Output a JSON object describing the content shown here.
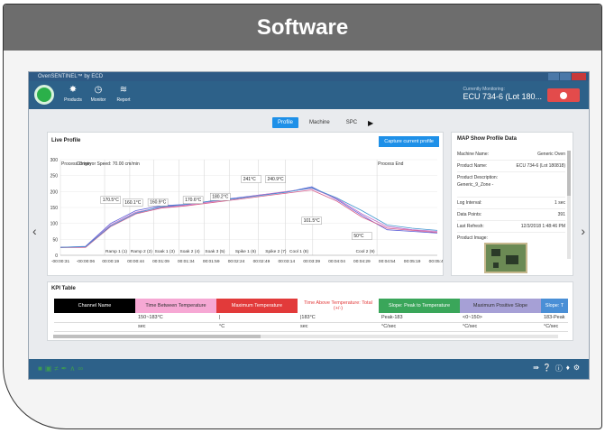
{
  "slide": {
    "title": "Software"
  },
  "window": {
    "title": "OvenSENTINEL™ by ECD"
  },
  "toolbar": {
    "items": [
      {
        "label": "Products",
        "icon": "products-icon"
      },
      {
        "label": "Monitor",
        "icon": "monitor-icon"
      },
      {
        "label": "Report",
        "icon": "report-icon"
      }
    ],
    "monitor_label": "Currently Monitoring:",
    "monitor_value": "ECU 734-6 (Lot 180..."
  },
  "tabs": [
    "Profile",
    "Machine",
    "SPC"
  ],
  "live_profile": {
    "title": "Live Profile",
    "capture_button": "Capture current profile"
  },
  "chart_data": {
    "type": "line",
    "title": "",
    "xlabel": "",
    "ylabel": "",
    "ylim": [
      0,
      300
    ],
    "yticks": [
      0,
      50,
      100,
      150,
      200,
      250,
      300
    ],
    "xticks": [
      "-00:00:31",
      "-00:00:06",
      "00:00:19",
      "00:00:44",
      "00:01:09",
      "00:01:34",
      "00:01:59",
      "00:02:24",
      "00:02:49",
      "00:03:14",
      "00:03:39",
      "00:04:04",
      "00:04:29",
      "00:04:54",
      "00:05:19",
      "00:05:44"
    ],
    "x": [
      -31,
      -6,
      19,
      44,
      69,
      94,
      119,
      144,
      169,
      194,
      219,
      244,
      269,
      294,
      319,
      344
    ],
    "colors": [
      "#5b5bd6",
      "#c06ac8",
      "#d65b8a",
      "#3f93cf"
    ],
    "series": [
      {
        "values": [
          25,
          28,
          100,
          140,
          155,
          160,
          170,
          180,
          190,
          198,
          215,
          175,
          125,
          80,
          75,
          70
        ]
      },
      {
        "values": [
          25,
          26,
          95,
          135,
          150,
          158,
          168,
          178,
          190,
          200,
          210,
          178,
          130,
          90,
          80,
          75
        ]
      },
      {
        "values": [
          24,
          25,
          90,
          130,
          148,
          155,
          165,
          175,
          185,
          195,
          205,
          170,
          120,
          85,
          78,
          72
        ]
      },
      {
        "values": [
          25,
          27,
          92,
          132,
          152,
          160,
          170,
          178,
          188,
          198,
          212,
          180,
          140,
          95,
          85,
          78
        ]
      }
    ],
    "header_labels": [
      {
        "text": "Process Origin",
        "x": -31
      },
      {
        "text": "Conveyor Speed: 70.00 cm/min",
        "x": -16
      },
      {
        "text": "Process End",
        "x": 284
      }
    ],
    "annotations": [
      {
        "text": "170.5°C",
        "x": 10,
        "y": 165
      },
      {
        "text": "160.1°C",
        "x": 32,
        "y": 157
      },
      {
        "text": "160.9°C",
        "x": 57,
        "y": 158
      },
      {
        "text": "170.6°C",
        "x": 92,
        "y": 165
      },
      {
        "text": "180.2°C",
        "x": 119,
        "y": 175
      },
      {
        "text": "241°C",
        "x": 150,
        "y": 230
      },
      {
        "text": "240.9°C",
        "x": 174,
        "y": 230
      },
      {
        "text": "101.5°C",
        "x": 210,
        "y": 100
      },
      {
        "text": "50°C",
        "x": 260,
        "y": 52
      }
    ],
    "zone_labels": [
      {
        "text": "Ramp 1 (1)",
        "x": 13
      },
      {
        "text": "Ramp 2 (2)",
        "x": 38
      },
      {
        "text": "Soak 1 (3)",
        "x": 62
      },
      {
        "text": "Soak 2 (4)",
        "x": 87
      },
      {
        "text": "Soak 3 (5)",
        "x": 112
      },
      {
        "text": "Spike 1 (6)",
        "x": 142
      },
      {
        "text": "Spike 2 (7)",
        "x": 172
      },
      {
        "text": "Cool 1 (8)",
        "x": 196
      },
      {
        "text": "Cool 2 (9)",
        "x": 262
      }
    ],
    "vlines": [
      -31,
      13,
      38,
      62,
      87,
      112,
      137,
      166,
      193,
      220,
      284
    ]
  },
  "map": {
    "title": "MAP Show Profile Data",
    "rows": [
      {
        "label": "Machine Name:",
        "value": "Generic Oven"
      },
      {
        "label": "Product Name:",
        "value": "ECU 734-6 (Lot 180818)"
      },
      {
        "label": "Product Description:",
        "value": "Generic_9_Zone -"
      },
      {
        "label": "Log Interval:",
        "value": "1 sec"
      },
      {
        "label": "Data Points:",
        "value": "391"
      },
      {
        "label": "Last Refresh:",
        "value": "12/3/2018 1:48:46 PM"
      }
    ],
    "image_label": "Product Image:"
  },
  "kpi": {
    "title": "KPI Table",
    "headers": [
      {
        "text": "Channel Name",
        "bg": "#000000",
        "color": "#ffffff"
      },
      {
        "text": "Time Between Temperature",
        "bg": "#f6a8d4",
        "color": "#333333"
      },
      {
        "text": "Maximum Temperature",
        "bg": "#e23a3a",
        "color": "#ffffff"
      },
      {
        "text": "Time Above Temperature: Total (+/-)",
        "bg": "#ffffff",
        "color": "#e23a3a"
      },
      {
        "text": "Slope: Peak to Temperature",
        "bg": "#3aa65a",
        "color": "#ffffff"
      },
      {
        "text": "Maximum Positive Slope",
        "bg": "#a6a0d6",
        "color": "#333333"
      },
      {
        "text": "Slope: T",
        "bg": "#4a8fd6",
        "color": "#ffffff"
      }
    ],
    "rows": [
      [
        "",
        "150~183°C",
        "|",
        "|183°C",
        "Peak-183",
        "<0~150>",
        "183-Peak"
      ],
      [
        "",
        "sec",
        "°C",
        "sec",
        "°C/sec",
        "°C/sec",
        "°C/sec"
      ]
    ]
  },
  "bottombar": {
    "right_icons": [
      "collapse-icon",
      "help-icon",
      "info-icon",
      "bell-icon",
      "settings-icon"
    ]
  }
}
